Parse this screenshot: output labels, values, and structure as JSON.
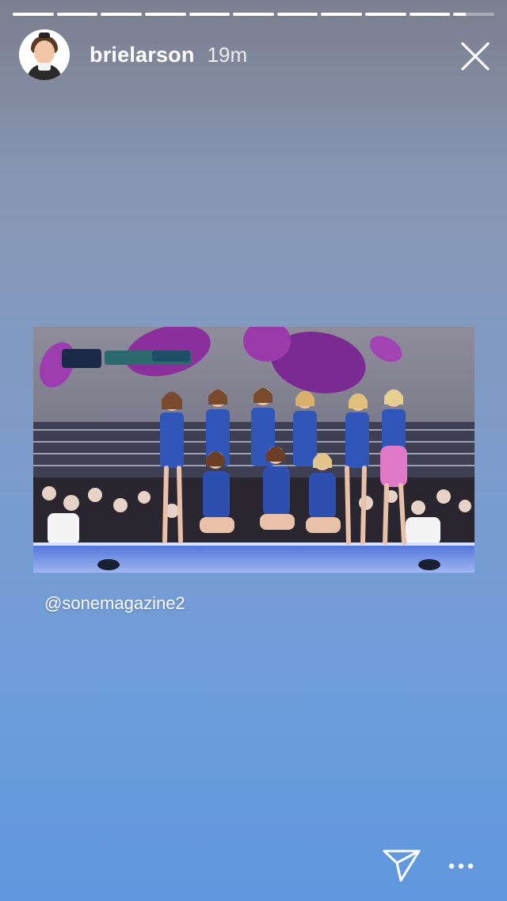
{
  "story": {
    "segments": [
      1,
      1,
      1,
      1,
      1,
      1,
      1,
      1,
      1,
      1,
      0.3
    ],
    "user": {
      "username": "brielarson",
      "time": "19m"
    },
    "mention": "@sonemagazine2"
  },
  "icons": {
    "close": "close-icon",
    "send": "direct-send-icon",
    "more": "more-options-icon"
  },
  "colors": {
    "bg_top": "#7b7f8e",
    "bg_bottom": "#5f98de",
    "text": "#ffffff"
  }
}
